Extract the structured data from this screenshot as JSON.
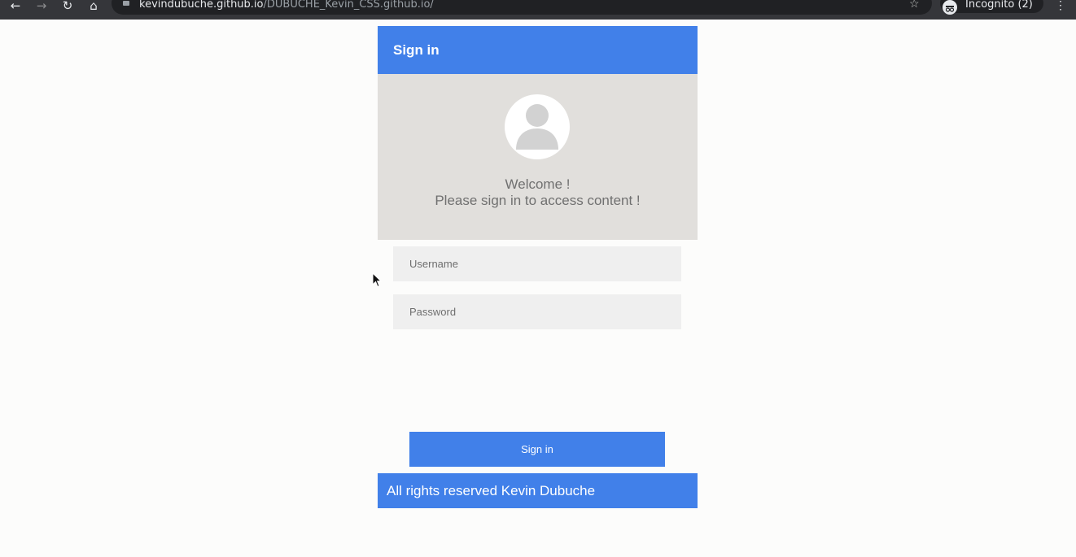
{
  "browser": {
    "back_glyph": "←",
    "forward_glyph": "→",
    "reload_glyph": "↻",
    "home_glyph": "⌂",
    "url_host": "kevindubuche.github.io",
    "url_path": "/DUBUCHE_Kevin_CSS.github.io/",
    "star_glyph": "☆",
    "incognito_label": "Incognito (2)",
    "menu_glyph": "⋮",
    "icons": [
      "back-icon",
      "forward-icon",
      "reload-icon",
      "home-icon",
      "lock-icon",
      "bookmark-star-icon",
      "incognito-icon",
      "kebab-menu-icon"
    ]
  },
  "card": {
    "title": "Sign in",
    "welcome_line1": "Welcome !",
    "welcome_line2": "Please sign in to access content !",
    "avatar_icon": "user-avatar-icon"
  },
  "form": {
    "username_placeholder": "Username",
    "username_value": "",
    "password_placeholder": "Password",
    "password_value": "",
    "submit_label": "Sign in"
  },
  "footer": {
    "text": "All rights reserved Kevin Dubuche"
  },
  "colors": {
    "brand_blue": "#4180e9",
    "hero_gray": "#e1dfdc",
    "field_gray": "#efefef",
    "page_bg": "#fcfcfb",
    "browser_chrome": "#35363a"
  }
}
